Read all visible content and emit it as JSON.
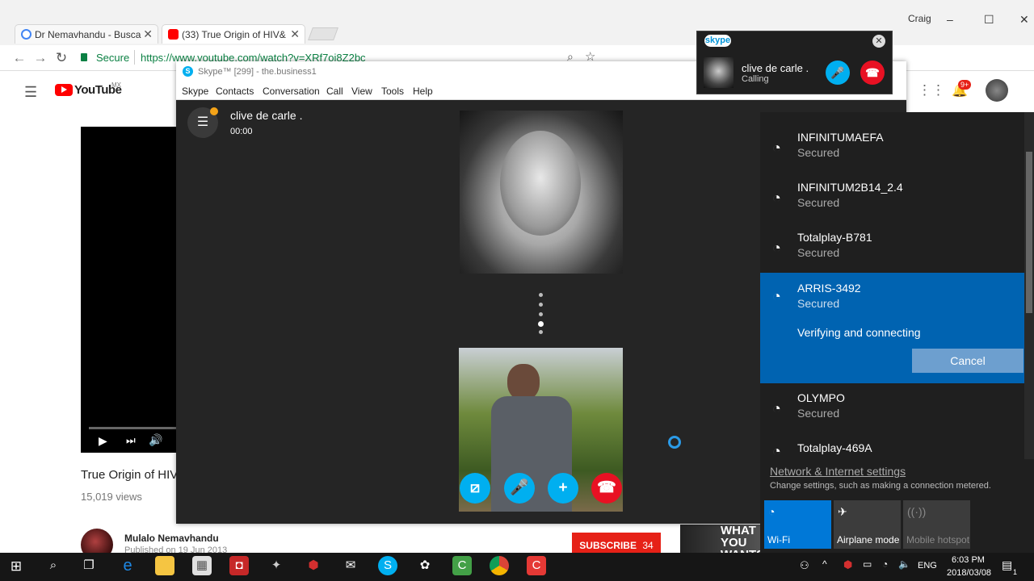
{
  "chrome": {
    "tabs": [
      {
        "label": "Dr Nemavhandu - Busca",
        "close": "✕"
      },
      {
        "label": "(33) True Origin of HIV&",
        "close": "✕"
      }
    ],
    "user": "Craig",
    "secure_label": "Secure",
    "url": "https://www.youtube.com/watch?v=XRf7oj8Z2bc",
    "window_controls": [
      "–",
      "☐",
      "✕"
    ]
  },
  "youtube": {
    "logo_text": "YouTube",
    "logo_region": "MX",
    "video_title": "True Origin of HIV",
    "views": "15,019 views",
    "channel_name": "Mulalo Nemavhandu",
    "published": "Published on 19 Jun 2013",
    "subscribe_label": "SUBSCRIBE",
    "subscribe_count": "34",
    "ad_text": "WHAT YOU WANTS",
    "notifications": "9+"
  },
  "skype": {
    "window_title": "Skype™ [299] - the.business1",
    "menu": [
      "Skype",
      "Contacts",
      "Conversation",
      "Call",
      "View",
      "Tools",
      "Help"
    ],
    "caller_name": "clive de carle .",
    "call_time": "00:00",
    "popup": {
      "badge": "skype",
      "name": "clive de carle .",
      "status": "Calling"
    }
  },
  "wifi": {
    "networks": [
      {
        "name": "INFINITUMAEFA",
        "security": "Secured"
      },
      {
        "name": "INFINITUM2B14_2.4",
        "security": "Secured"
      },
      {
        "name": "Totalplay-B781",
        "security": "Secured"
      },
      {
        "name": "ARRIS-3492",
        "security": "Secured"
      },
      {
        "name": "OLYMPO",
        "security": "Secured"
      },
      {
        "name": "Totalplay-469A",
        "security": ""
      }
    ],
    "verifying_text": "Verifying and connecting",
    "cancel_label": "Cancel",
    "settings_link": "Network & Internet settings",
    "settings_desc": "Change settings, such as making a connection metered.",
    "quick_actions": [
      {
        "label": "Wi-Fi",
        "icon": "wifi-icon",
        "active": true
      },
      {
        "label": "Airplane mode",
        "icon": "airplane-icon",
        "active": false
      },
      {
        "label": "Mobile hotspot",
        "icon": "hotspot-icon",
        "active": false
      }
    ]
  },
  "taskbar": {
    "lang": "ENG",
    "time": "6:03 PM",
    "date": "2018/03/08",
    "notification_count": "1"
  },
  "colors": {
    "skype_blue": "#00aff0",
    "end_call_red": "#e81123",
    "wifi_accent": "#0063b1",
    "youtube_red": "#ff0000"
  }
}
